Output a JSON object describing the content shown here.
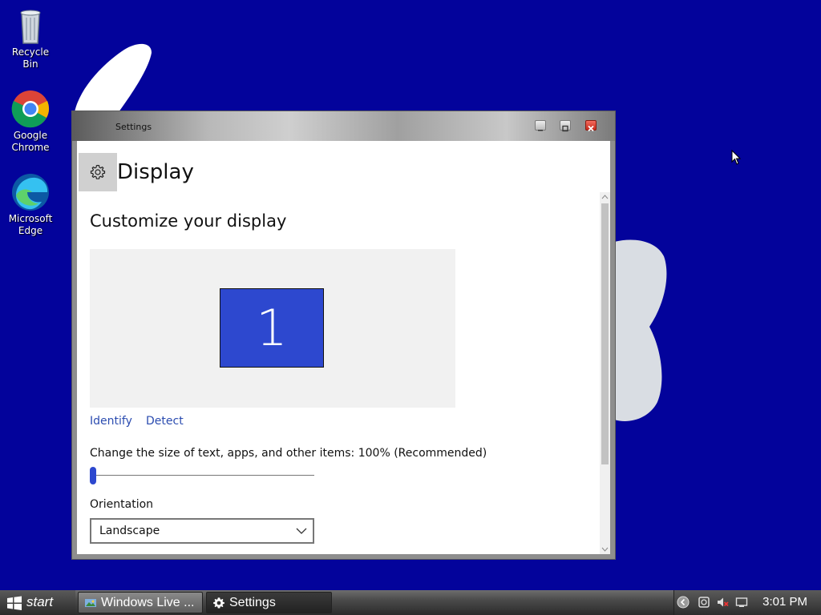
{
  "desktop": {
    "icons": [
      {
        "label": "Recycle Bin"
      },
      {
        "label": "Google Chrome"
      },
      {
        "label": "Microsoft Edge"
      }
    ]
  },
  "window": {
    "title": "Settings",
    "page_title": "Display",
    "section_title": "Customize your display",
    "monitor_number": "1",
    "identify_link": "Identify",
    "detect_link": "Detect",
    "scale_label": "Change the size of text, apps, and other items: 100% (Recommended)",
    "scale_value_percent": 100,
    "orientation_label": "Orientation",
    "orientation_value": "Landscape"
  },
  "taskbar": {
    "start_label": "start",
    "tasks": [
      {
        "label": "Windows Live ...",
        "icon": "windows-live-icon"
      },
      {
        "label": "Settings",
        "icon": "gear-icon"
      }
    ],
    "clock": "3:01 PM"
  },
  "colors": {
    "desktop_bg": "#03039b",
    "monitor_tile": "#2d48cf",
    "link": "#2b4cb0",
    "close_button": "#d9382b"
  }
}
